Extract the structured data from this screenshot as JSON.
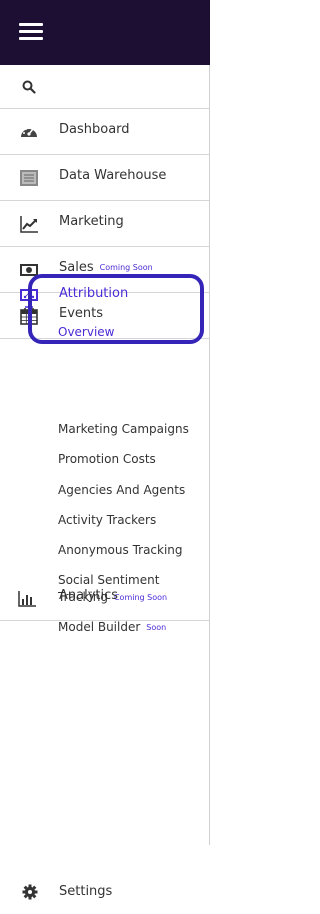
{
  "topbar": {
    "menu_icon": "hamburger-icon"
  },
  "search": {
    "icon": "search-icon"
  },
  "nav": [
    {
      "label": "Dashboard",
      "icon": "gauge-icon"
    },
    {
      "label": "Data Warehouse",
      "icon": "database-icon"
    },
    {
      "label": "Marketing",
      "icon": "chart-line-icon"
    },
    {
      "label": "Sales",
      "icon": "money-icon",
      "badge": "Coming Soon"
    },
    {
      "label": "Events",
      "icon": "calendar-icon"
    }
  ],
  "attribution": {
    "label": "Attribution",
    "icon": "presentation-icon",
    "overview": "Overview",
    "subitems": [
      {
        "label": "Marketing Campaigns"
      },
      {
        "label": "Promotion Costs"
      },
      {
        "label": "Agencies And Agents"
      },
      {
        "label": "Activity Trackers"
      },
      {
        "label": "Anonymous Tracking"
      },
      {
        "label": "Social Sentiment"
      },
      {
        "label": "Tracking",
        "badge": "Coming Soon"
      },
      {
        "label": "Model Builder",
        "badge": "Soon"
      }
    ]
  },
  "analytics": {
    "label": "Analytics",
    "icon": "bar-chart-icon"
  },
  "settings": {
    "label": "Settings",
    "icon": "gear-icon"
  },
  "colors": {
    "topbar": "#1c0f33",
    "accent": "#4b2bd6",
    "highlight_border": "#3524b8"
  }
}
